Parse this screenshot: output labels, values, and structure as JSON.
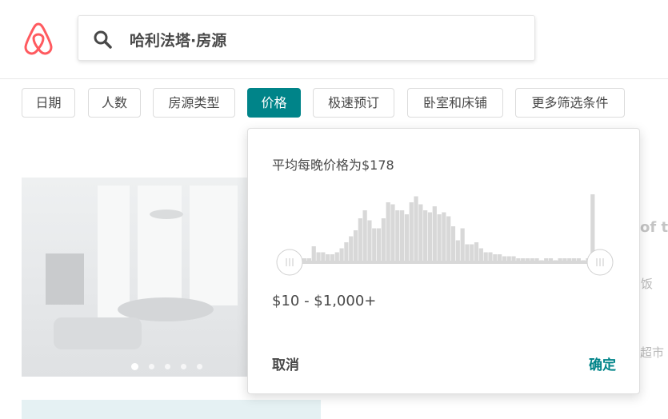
{
  "search": {
    "text": "哈利法塔·房源"
  },
  "filters": [
    {
      "label": "日期"
    },
    {
      "label": "人数"
    },
    {
      "label": "房源类型"
    },
    {
      "label": "价格",
      "active": true
    },
    {
      "label": "极速预订"
    },
    {
      "label": "卧室和床铺"
    },
    {
      "label": "更多筛选条件"
    }
  ],
  "price_popup": {
    "average_text": "平均每晚价格为$178",
    "range_text": "$10 - $1,000+",
    "cancel_label": "取消",
    "confirm_label": "确定",
    "histogram": [
      2,
      2,
      8,
      5,
      5,
      4,
      4,
      5,
      7,
      10,
      13,
      16,
      22,
      26,
      21,
      17,
      17,
      22,
      30,
      29,
      26,
      26,
      24,
      30,
      33,
      29,
      26,
      25,
      28,
      24,
      25,
      23,
      18,
      11,
      17,
      9,
      9,
      10,
      7,
      5,
      5,
      4,
      4,
      3,
      3,
      3,
      2,
      2,
      2,
      2,
      2,
      1,
      2,
      2,
      1,
      2,
      2,
      2,
      2,
      2,
      1,
      2,
      34
    ]
  },
  "partial_listing": {
    "title_fragment": "of th",
    "text_fragment_1": "饭",
    "text_fragment_2": "超市"
  },
  "colors": {
    "accent": "#008489",
    "brand": "#FF5A5F",
    "histogram_bar": "#d8d8d8"
  },
  "icons": [
    "airbnb-logo-icon",
    "search-icon"
  ]
}
